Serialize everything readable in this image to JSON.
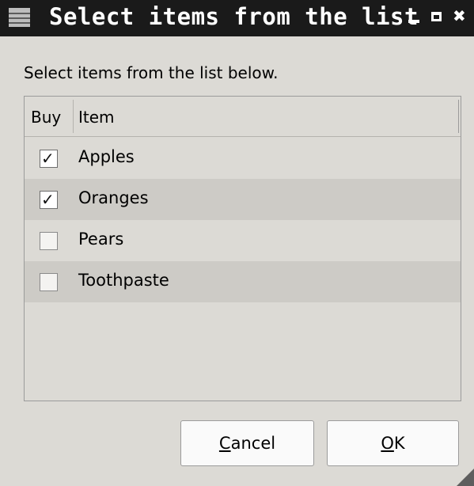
{
  "window": {
    "title": "Select items from the list",
    "close_glyph": "✖"
  },
  "dialog": {
    "instruction": "Select items from the list below.",
    "columns": [
      "Buy",
      "Item"
    ],
    "rows": [
      {
        "item": "Apples",
        "buy": true
      },
      {
        "item": "Oranges",
        "buy": true
      },
      {
        "item": "Pears",
        "buy": false
      },
      {
        "item": "Toothpaste",
        "buy": false
      }
    ],
    "check_glyph": "✓"
  },
  "buttons": {
    "cancel_mnemonic": "C",
    "cancel_rest": "ancel",
    "ok_mnemonic": "O",
    "ok_rest": "K"
  },
  "icons": {
    "window_menu": "window-menu-icon",
    "minimize": "minimize-icon",
    "maximize": "maximize-icon",
    "close": "close-icon",
    "resize_grip": "resize-grip-icon"
  }
}
